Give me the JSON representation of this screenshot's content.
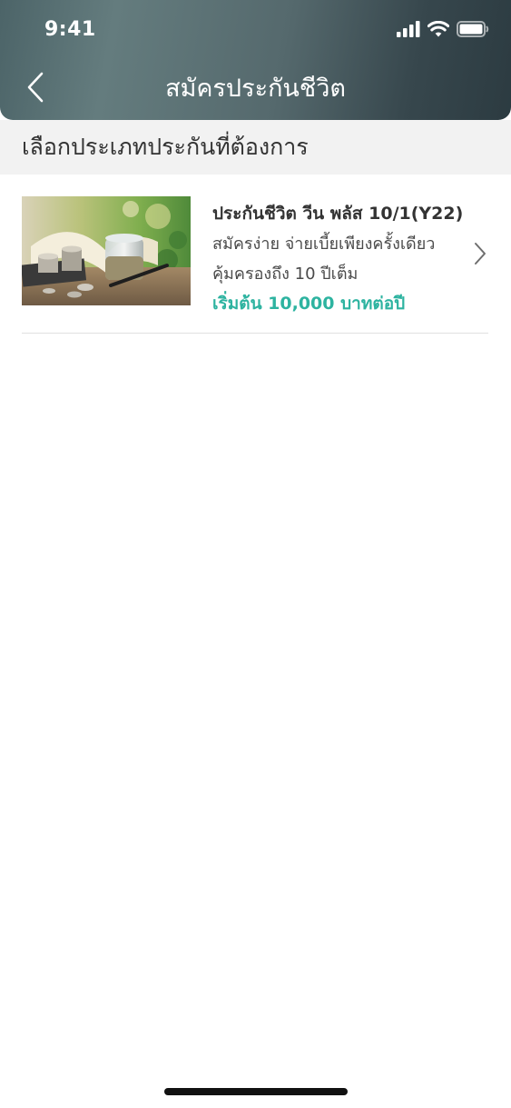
{
  "status_bar": {
    "time": "9:41",
    "icons": [
      "signal-icon",
      "wifi-icon",
      "battery-icon"
    ]
  },
  "header": {
    "back_icon": "chevron-left-icon",
    "title": "สมัครประกันชีวิต"
  },
  "section": {
    "label": "เลือกประเภทประกันที่ต้องการ"
  },
  "products": [
    {
      "image": "coins-jar-photo",
      "title": "ประกันชีวิต วีน พลัส 10/1(Y22)",
      "line1": "สมัครง่าย จ่ายเบี้ยเพียงครั้งเดียว",
      "line2": "คุ้มครองถึง 10 ปีเต็ม",
      "price": "เริ่มต้น 10,000 บาทต่อปี",
      "chevron_icon": "chevron-right-icon"
    }
  ],
  "colors": {
    "header_start": "#4c6468",
    "header_end": "#2c3b41",
    "section_bg": "#f2f2f2",
    "price_accent": "#2db3a0"
  }
}
